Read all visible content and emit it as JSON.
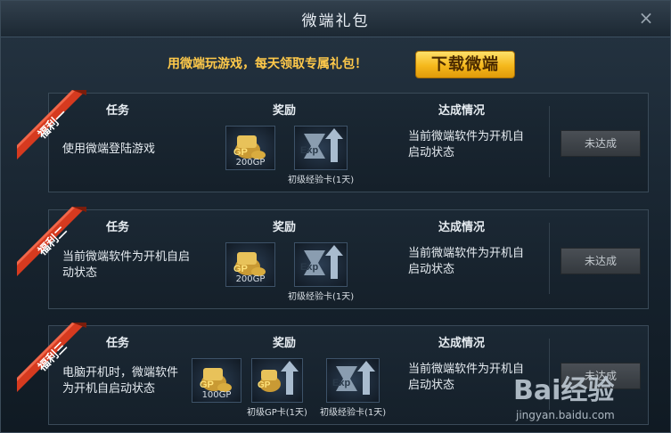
{
  "dialog": {
    "title": "微端礼包",
    "close_symbol": "×"
  },
  "promo": {
    "text": "用微端玩游戏，每天领取专属礼包！",
    "button_label": "下载微端"
  },
  "headers": {
    "task": "任务",
    "reward": "奖励",
    "status": "达成情况"
  },
  "panels": [
    {
      "ribbon": "福利一",
      "task": "使用微端登陆游戏",
      "status_text": "当前微端软件为开机自启动状态",
      "button": "未达成",
      "rewards": [
        {
          "icon": "gp-coins-icon",
          "caption": "200GP"
        },
        {
          "icon": "exp-card-icon",
          "caption": "初级经验卡(1天)"
        }
      ]
    },
    {
      "ribbon": "福利二",
      "task": "当前微端软件为开机自启动状态",
      "status_text": "当前微端软件为开机自启动状态",
      "button": "未达成",
      "rewards": [
        {
          "icon": "gp-coins-icon",
          "caption": "200GP"
        },
        {
          "icon": "exp-card-icon",
          "caption": "初级经验卡(1天)"
        }
      ]
    },
    {
      "ribbon": "福利三",
      "task": "电脑开机时，微端软件为开机自启动状态",
      "status_text": "当前微端软件为开机自启动状态",
      "button": "未达成",
      "rewards": [
        {
          "icon": "gp-coins-icon",
          "caption": "100GP"
        },
        {
          "icon": "gp-card-icon",
          "caption": "初级GP卡(1天)"
        },
        {
          "icon": "exp-card-icon",
          "caption": "初级经验卡(1天)"
        }
      ]
    }
  ],
  "watermark": {
    "logo": "Bai经验",
    "url": "jingyan.baidu.com"
  },
  "colors": {
    "accent_gold": "#ffc94a",
    "ribbon_red": "#d63a1f",
    "panel_bg": "#1b2834"
  }
}
